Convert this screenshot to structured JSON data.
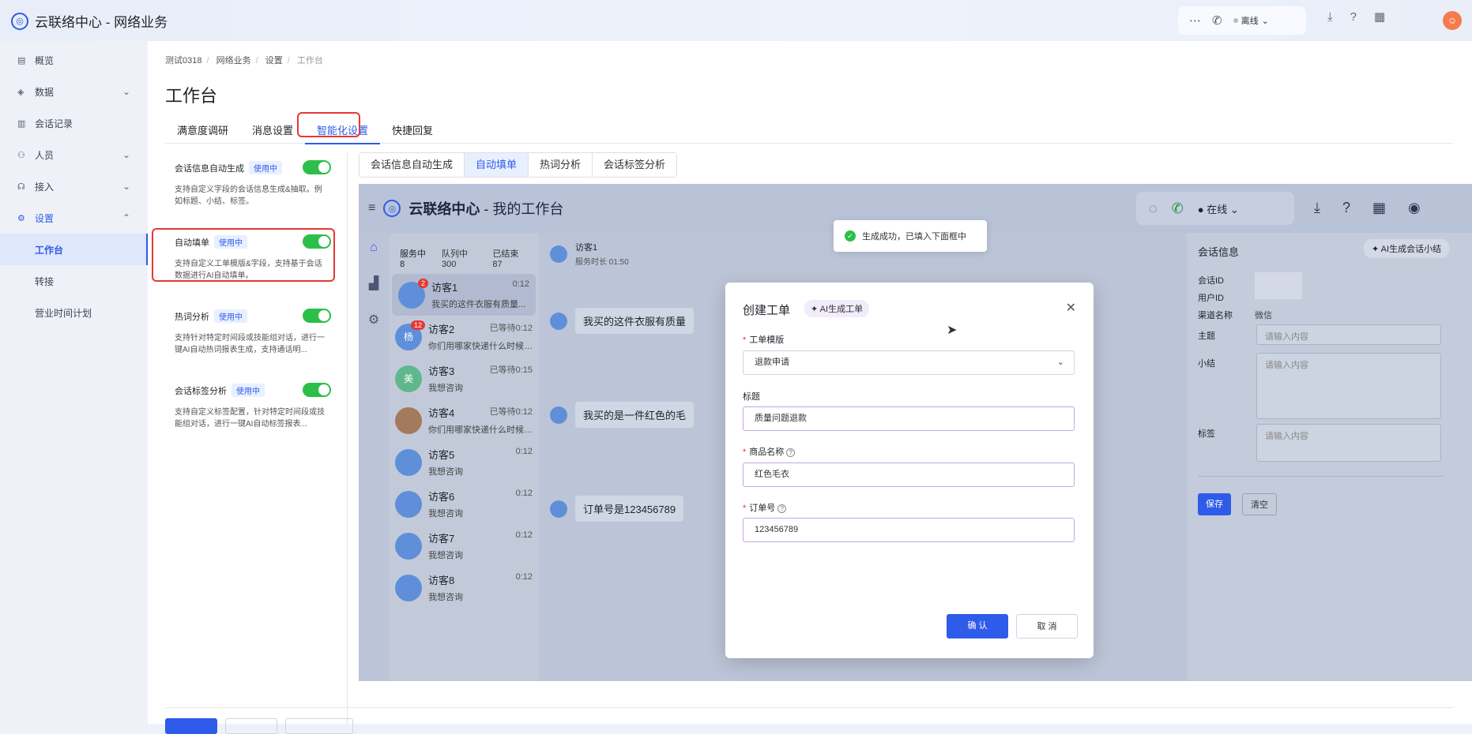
{
  "app": {
    "title": "云联络中心 - 网络业务",
    "logo_glyph": "◎"
  },
  "topbar": {
    "status": "离线",
    "icons": [
      "chat-icon",
      "phone-icon",
      "download-icon",
      "help-icon",
      "grid-icon"
    ]
  },
  "sidebar": {
    "items": [
      {
        "label": "概览"
      },
      {
        "label": "数据"
      },
      {
        "label": "会话记录"
      },
      {
        "label": "人员"
      },
      {
        "label": "接入"
      },
      {
        "label": "设置"
      },
      {
        "label": "工作台"
      },
      {
        "label": "转接"
      },
      {
        "label": "营业时间计划"
      }
    ]
  },
  "breadcrumb": [
    "测试0318",
    "网络业务",
    "设置",
    "工作台"
  ],
  "page_title": "工作台",
  "tabs": [
    "满意度调研",
    "消息设置",
    "智能化设置",
    "快捷回复"
  ],
  "features": [
    {
      "title": "会话信息自动生成",
      "badge": "使用中",
      "desc": "支持自定义字段的会话信息生成&抽取。例如标题、小结、标签。"
    },
    {
      "title": "自动填单",
      "badge": "使用中",
      "desc": "支持自定义工单模版&字段，支持基于会话数据进行AI自动填单。"
    },
    {
      "title": "热词分析",
      "badge": "使用中",
      "desc": "支持针对特定时间段或技能组对话，进行一键AI自动热词报表生成，支持通话明..."
    },
    {
      "title": "会话标签分析",
      "badge": "使用中",
      "desc": "支持自定义标签配置，针对特定时间段或技能组对话，进行一键AI自动标签报表..."
    }
  ],
  "subtabs": [
    "会话信息自动生成",
    "自动填单",
    "热词分析",
    "会话标签分析"
  ],
  "preview": {
    "title_main": "云联络中心",
    "title_sep": " - ",
    "title_sub": "我的工作台",
    "status": "在线",
    "list_tabs": [
      "服务中 8",
      "队列中 300",
      "已结束 87"
    ],
    "visitors": [
      {
        "name": "访客1",
        "time": "0:12",
        "msg": "我买的这件衣服有质量...",
        "badge": "2",
        "initial": ""
      },
      {
        "name": "访客2",
        "time": "已等待0:12",
        "msg": "你们用哪家快递什么时候发...",
        "badge": "12",
        "initial": "杨"
      },
      {
        "name": "访客3",
        "time": "已等待0:15",
        "msg": "我想咨询",
        "badge": "",
        "initial": "美"
      },
      {
        "name": "访客4",
        "time": "已等待0:12",
        "msg": "你们用哪家快递什么时候发...",
        "badge": "",
        "initial": ""
      },
      {
        "name": "访客5",
        "time": "0:12",
        "msg": "我想咨询",
        "badge": "",
        "initial": ""
      },
      {
        "name": "访客6",
        "time": "0:12",
        "msg": "我想咨询",
        "badge": "",
        "initial": ""
      },
      {
        "name": "访客7",
        "time": "0:12",
        "msg": "我想咨询",
        "badge": "",
        "initial": ""
      },
      {
        "name": "访客8",
        "time": "0:12",
        "msg": "我想咨询",
        "badge": "",
        "initial": ""
      }
    ],
    "chat": {
      "name": "访客1",
      "duration": "服务时长 01:50",
      "messages": [
        "我买的这件衣服有质量",
        "我买的是一件红色的毛",
        "订单号是123456789"
      ]
    },
    "info": {
      "title": "会话信息",
      "ai_button": "AI生成会话小结",
      "rows": [
        {
          "label": "会话ID",
          "value": ""
        },
        {
          "label": "用户ID",
          "value": ""
        },
        {
          "label": "渠道名称",
          "value": "微信"
        }
      ],
      "fields": [
        {
          "label": "主题",
          "placeholder": "请输入内容"
        },
        {
          "label": "小结",
          "placeholder": "请输入内容"
        },
        {
          "label": "标签",
          "placeholder": "请输入内容"
        }
      ],
      "save": "保存",
      "clear": "清空"
    }
  },
  "toast": "生成成功，已填入下面框中",
  "modal": {
    "title": "创建工单",
    "ai_tag": "AI生成工单",
    "fields": [
      {
        "label": "工单模版",
        "value": "退款申请",
        "required": "*"
      },
      {
        "label": "标题",
        "value": "质量问题退款",
        "required": ""
      },
      {
        "label": "商品名称",
        "value": "红色毛衣",
        "required": "*"
      },
      {
        "label": "订单号",
        "value": "123456789",
        "required": "*"
      }
    ],
    "confirm": "确 认",
    "cancel": "取 消"
  },
  "colors": {
    "accent": "#2f5bea",
    "toggle_on": "#2bbf4a",
    "highlight": "#e53935"
  }
}
